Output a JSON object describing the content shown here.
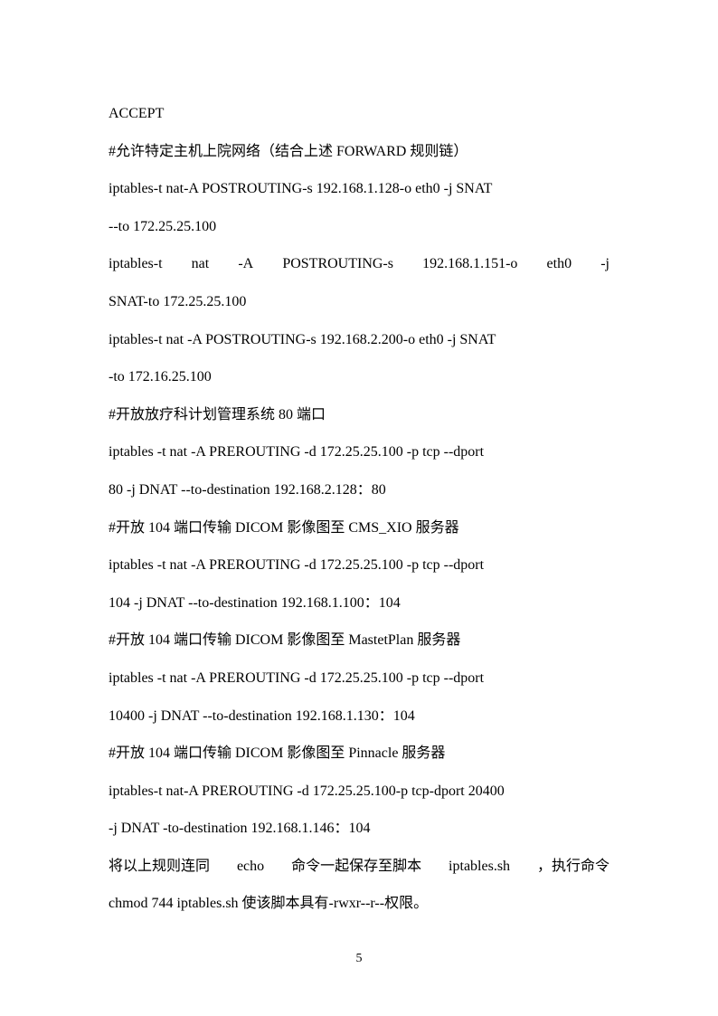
{
  "lines": [
    "ACCEPT",
    "#允许特定主机上院网络（结合上述 FORWARD 规则链）",
    "iptables-t nat-A POSTROUTING-s 192.168.1.128-o eth0 -j SNAT",
    "--to 172.25.25.100",
    "iptables-t nat -A POSTROUTING-s 192.168.1.151-o eth0 -j",
    "SNAT-to 172.25.25.100",
    "iptables-t nat -A POSTROUTING-s 192.168.2.200-o eth0 -j SNAT",
    "-to 172.16.25.100",
    "#开放放疗科计划管理系统 80 端口",
    "iptables -t nat -A PREROUTING -d 172.25.25.100 -p tcp --dport",
    "80 -j DNAT --to-destination 192.168.2.128：80",
    "#开放 104 端口传输 DICOM 影像图至 CMS_XIO 服务器",
    "iptables -t nat -A PREROUTING -d 172.25.25.100 -p tcp --dport",
    "104 -j DNAT --to-destination 192.168.1.100：104",
    "#开放 104 端口传输 DICOM 影像图至 MastetPlan 服务器",
    "iptables -t nat -A PREROUTING -d 172.25.25.100 -p tcp --dport",
    "10400 -j DNAT --to-destination 192.168.1.130：104",
    "#开放 104 端口传输 DICOM 影像图至 Pinnacle 服务器",
    "iptables-t nat-A PREROUTING -d 172.25.25.100-p tcp-dport 20400",
    "-j DNAT -to-destination 192.168.1.146：104",
    "将以上规则连同 echo 命令一起保存至脚本 iptables.sh ，执行命令",
    "chmod 744 iptables.sh 使该脚本具有-rwxr--r--权限。"
  ],
  "justifyLines": [
    4,
    20
  ],
  "pageNumber": "5"
}
